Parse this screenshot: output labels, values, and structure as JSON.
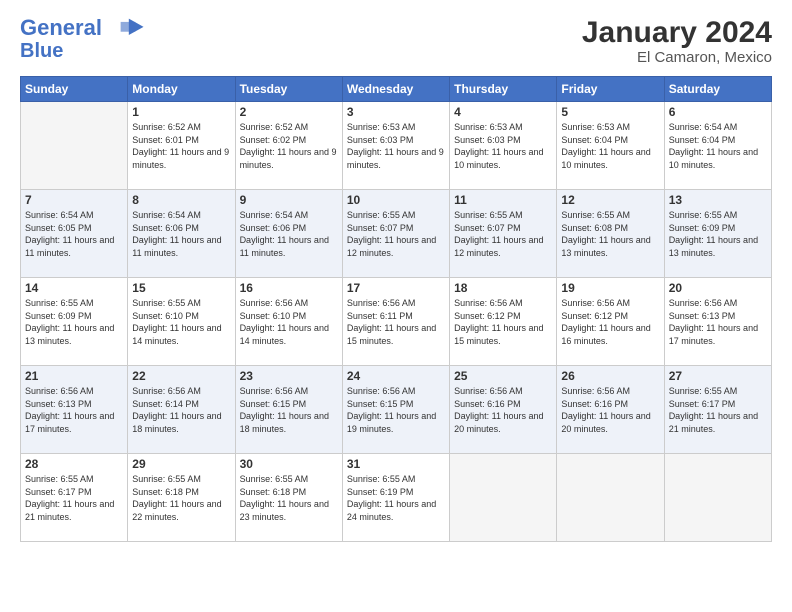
{
  "header": {
    "logo_line1": "General",
    "logo_line2": "Blue",
    "title": "January 2024",
    "subtitle": "El Camaron, Mexico"
  },
  "weekdays": [
    "Sunday",
    "Monday",
    "Tuesday",
    "Wednesday",
    "Thursday",
    "Friday",
    "Saturday"
  ],
  "weeks": [
    [
      {
        "day": "",
        "sunrise": "",
        "sunset": "",
        "daylight": ""
      },
      {
        "day": "1",
        "sunrise": "Sunrise: 6:52 AM",
        "sunset": "Sunset: 6:01 PM",
        "daylight": "Daylight: 11 hours and 9 minutes."
      },
      {
        "day": "2",
        "sunrise": "Sunrise: 6:52 AM",
        "sunset": "Sunset: 6:02 PM",
        "daylight": "Daylight: 11 hours and 9 minutes."
      },
      {
        "day": "3",
        "sunrise": "Sunrise: 6:53 AM",
        "sunset": "Sunset: 6:03 PM",
        "daylight": "Daylight: 11 hours and 9 minutes."
      },
      {
        "day": "4",
        "sunrise": "Sunrise: 6:53 AM",
        "sunset": "Sunset: 6:03 PM",
        "daylight": "Daylight: 11 hours and 10 minutes."
      },
      {
        "day": "5",
        "sunrise": "Sunrise: 6:53 AM",
        "sunset": "Sunset: 6:04 PM",
        "daylight": "Daylight: 11 hours and 10 minutes."
      },
      {
        "day": "6",
        "sunrise": "Sunrise: 6:54 AM",
        "sunset": "Sunset: 6:04 PM",
        "daylight": "Daylight: 11 hours and 10 minutes."
      }
    ],
    [
      {
        "day": "7",
        "sunrise": "Sunrise: 6:54 AM",
        "sunset": "Sunset: 6:05 PM",
        "daylight": "Daylight: 11 hours and 11 minutes."
      },
      {
        "day": "8",
        "sunrise": "Sunrise: 6:54 AM",
        "sunset": "Sunset: 6:06 PM",
        "daylight": "Daylight: 11 hours and 11 minutes."
      },
      {
        "day": "9",
        "sunrise": "Sunrise: 6:54 AM",
        "sunset": "Sunset: 6:06 PM",
        "daylight": "Daylight: 11 hours and 11 minutes."
      },
      {
        "day": "10",
        "sunrise": "Sunrise: 6:55 AM",
        "sunset": "Sunset: 6:07 PM",
        "daylight": "Daylight: 11 hours and 12 minutes."
      },
      {
        "day": "11",
        "sunrise": "Sunrise: 6:55 AM",
        "sunset": "Sunset: 6:07 PM",
        "daylight": "Daylight: 11 hours and 12 minutes."
      },
      {
        "day": "12",
        "sunrise": "Sunrise: 6:55 AM",
        "sunset": "Sunset: 6:08 PM",
        "daylight": "Daylight: 11 hours and 13 minutes."
      },
      {
        "day": "13",
        "sunrise": "Sunrise: 6:55 AM",
        "sunset": "Sunset: 6:09 PM",
        "daylight": "Daylight: 11 hours and 13 minutes."
      }
    ],
    [
      {
        "day": "14",
        "sunrise": "Sunrise: 6:55 AM",
        "sunset": "Sunset: 6:09 PM",
        "daylight": "Daylight: 11 hours and 13 minutes."
      },
      {
        "day": "15",
        "sunrise": "Sunrise: 6:55 AM",
        "sunset": "Sunset: 6:10 PM",
        "daylight": "Daylight: 11 hours and 14 minutes."
      },
      {
        "day": "16",
        "sunrise": "Sunrise: 6:56 AM",
        "sunset": "Sunset: 6:10 PM",
        "daylight": "Daylight: 11 hours and 14 minutes."
      },
      {
        "day": "17",
        "sunrise": "Sunrise: 6:56 AM",
        "sunset": "Sunset: 6:11 PM",
        "daylight": "Daylight: 11 hours and 15 minutes."
      },
      {
        "day": "18",
        "sunrise": "Sunrise: 6:56 AM",
        "sunset": "Sunset: 6:12 PM",
        "daylight": "Daylight: 11 hours and 15 minutes."
      },
      {
        "day": "19",
        "sunrise": "Sunrise: 6:56 AM",
        "sunset": "Sunset: 6:12 PM",
        "daylight": "Daylight: 11 hours and 16 minutes."
      },
      {
        "day": "20",
        "sunrise": "Sunrise: 6:56 AM",
        "sunset": "Sunset: 6:13 PM",
        "daylight": "Daylight: 11 hours and 17 minutes."
      }
    ],
    [
      {
        "day": "21",
        "sunrise": "Sunrise: 6:56 AM",
        "sunset": "Sunset: 6:13 PM",
        "daylight": "Daylight: 11 hours and 17 minutes."
      },
      {
        "day": "22",
        "sunrise": "Sunrise: 6:56 AM",
        "sunset": "Sunset: 6:14 PM",
        "daylight": "Daylight: 11 hours and 18 minutes."
      },
      {
        "day": "23",
        "sunrise": "Sunrise: 6:56 AM",
        "sunset": "Sunset: 6:15 PM",
        "daylight": "Daylight: 11 hours and 18 minutes."
      },
      {
        "day": "24",
        "sunrise": "Sunrise: 6:56 AM",
        "sunset": "Sunset: 6:15 PM",
        "daylight": "Daylight: 11 hours and 19 minutes."
      },
      {
        "day": "25",
        "sunrise": "Sunrise: 6:56 AM",
        "sunset": "Sunset: 6:16 PM",
        "daylight": "Daylight: 11 hours and 20 minutes."
      },
      {
        "day": "26",
        "sunrise": "Sunrise: 6:56 AM",
        "sunset": "Sunset: 6:16 PM",
        "daylight": "Daylight: 11 hours and 20 minutes."
      },
      {
        "day": "27",
        "sunrise": "Sunrise: 6:55 AM",
        "sunset": "Sunset: 6:17 PM",
        "daylight": "Daylight: 11 hours and 21 minutes."
      }
    ],
    [
      {
        "day": "28",
        "sunrise": "Sunrise: 6:55 AM",
        "sunset": "Sunset: 6:17 PM",
        "daylight": "Daylight: 11 hours and 21 minutes."
      },
      {
        "day": "29",
        "sunrise": "Sunrise: 6:55 AM",
        "sunset": "Sunset: 6:18 PM",
        "daylight": "Daylight: 11 hours and 22 minutes."
      },
      {
        "day": "30",
        "sunrise": "Sunrise: 6:55 AM",
        "sunset": "Sunset: 6:18 PM",
        "daylight": "Daylight: 11 hours and 23 minutes."
      },
      {
        "day": "31",
        "sunrise": "Sunrise: 6:55 AM",
        "sunset": "Sunset: 6:19 PM",
        "daylight": "Daylight: 11 hours and 24 minutes."
      },
      {
        "day": "",
        "sunrise": "",
        "sunset": "",
        "daylight": ""
      },
      {
        "day": "",
        "sunrise": "",
        "sunset": "",
        "daylight": ""
      },
      {
        "day": "",
        "sunrise": "",
        "sunset": "",
        "daylight": ""
      }
    ]
  ]
}
